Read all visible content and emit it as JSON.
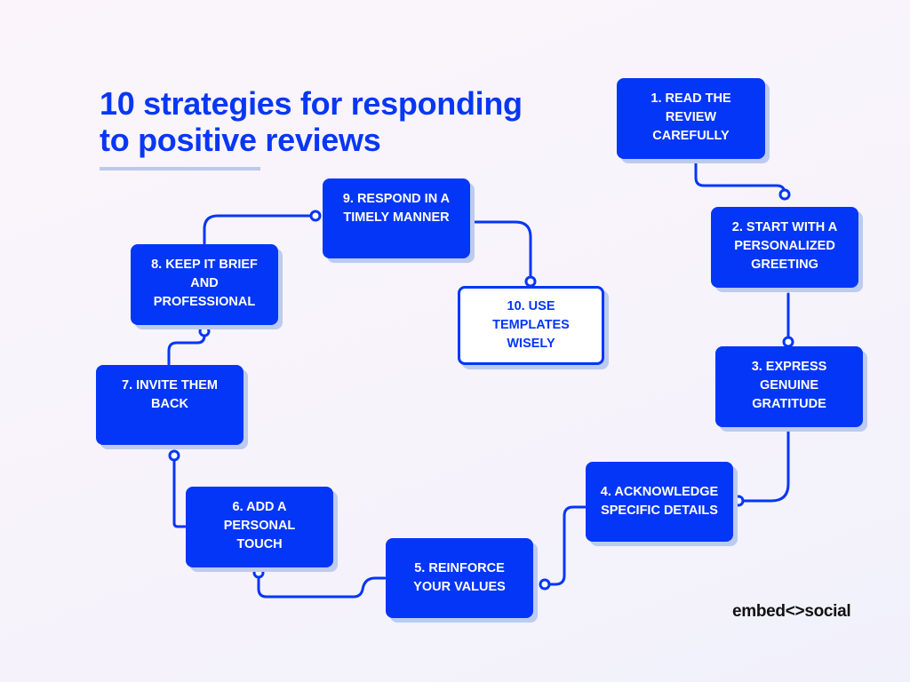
{
  "title": {
    "lines": [
      "10 strategies for responding",
      "to positive reviews"
    ]
  },
  "steps": [
    {
      "number": 1,
      "lines": [
        "1. READ THE",
        "REVIEW",
        "CAREFULLY"
      ],
      "style": "filled"
    },
    {
      "number": 2,
      "lines": [
        "2. START WITH A",
        "PERSONALIZED",
        "GREETING"
      ],
      "style": "filled"
    },
    {
      "number": 3,
      "lines": [
        "3. EXPRESS",
        "GENUINE",
        "GRATITUDE"
      ],
      "style": "filled"
    },
    {
      "number": 4,
      "lines": [
        "4. ACKNOWLEDGE",
        "SPECIFIC DETAILS"
      ],
      "style": "filled"
    },
    {
      "number": 5,
      "lines": [
        "5. REINFORCE",
        "YOUR VALUES"
      ],
      "style": "filled"
    },
    {
      "number": 6,
      "lines": [
        "6. ADD A",
        "PERSONAL",
        "TOUCH"
      ],
      "style": "filled"
    },
    {
      "number": 7,
      "lines": [
        "7. INVITE THEM",
        "BACK"
      ],
      "style": "filled"
    },
    {
      "number": 8,
      "lines": [
        "8. KEEP IT BRIEF",
        "AND",
        "PROFESSIONAL"
      ],
      "style": "filled"
    },
    {
      "number": 9,
      "lines": [
        "9. RESPOND IN A",
        "TIMELY MANNER"
      ],
      "style": "filled"
    },
    {
      "number": 10,
      "lines": [
        "10. USE",
        "TEMPLATES",
        "WISELY"
      ],
      "style": "outlined"
    }
  ],
  "flow": [
    "1→2",
    "2→3",
    "3→4",
    "4→5",
    "5→6",
    "6→7",
    "7→8",
    "8→9",
    "9→10"
  ],
  "colors": {
    "accent": "#0436f7",
    "shadow": "#bccbee",
    "background": "#f7f3fb",
    "title": "#0737f5"
  },
  "brand": {
    "logo_text": "embed<>social"
  }
}
